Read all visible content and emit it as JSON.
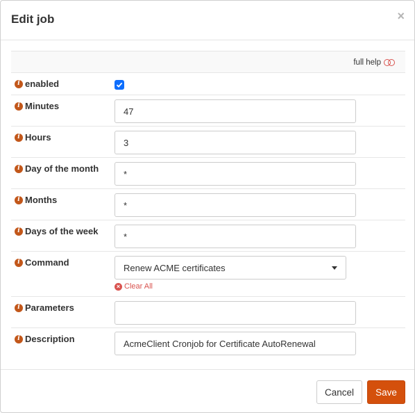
{
  "dialog": {
    "title": "Edit job",
    "close_symbol": "×"
  },
  "help": {
    "label": "full help"
  },
  "fields": {
    "enabled": {
      "label": "enabled",
      "checked": true
    },
    "minutes": {
      "label": "Minutes",
      "value": "47"
    },
    "hours": {
      "label": "Hours",
      "value": "3"
    },
    "day_of_month": {
      "label": "Day of the month",
      "value": "*"
    },
    "months": {
      "label": "Months",
      "value": "*"
    },
    "days_of_week": {
      "label": "Days of the week",
      "value": "*"
    },
    "command": {
      "label": "Command",
      "selected": "Renew ACME certificates",
      "clear_label": "Clear All"
    },
    "parameters": {
      "label": "Parameters",
      "value": ""
    },
    "description": {
      "label": "Description",
      "value": "AcmeClient Cronjob for Certificate AutoRenewal"
    }
  },
  "footer": {
    "cancel_label": "Cancel",
    "save_label": "Save"
  },
  "colors": {
    "accent": "#d4500c",
    "info_icon": "#c2571a",
    "checkbox": "#0d6efd",
    "danger": "#d9534f"
  }
}
